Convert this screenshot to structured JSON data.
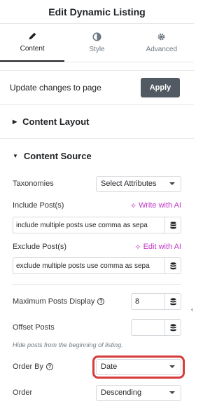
{
  "header": {
    "title": "Edit Dynamic Listing"
  },
  "tabs": [
    {
      "label": "Content",
      "icon": "pencil-icon"
    },
    {
      "label": "Style",
      "icon": "contrast-icon"
    },
    {
      "label": "Advanced",
      "icon": "gear-icon"
    }
  ],
  "apply": {
    "label": "Update changes to page",
    "button": "Apply"
  },
  "sections": {
    "layout": "Content Layout",
    "source": "Content Source"
  },
  "fields": {
    "taxonomies": {
      "label": "Taxonomies",
      "value": "Select Attributes"
    },
    "include": {
      "label": "Include Post(s)",
      "ai": "Write with AI",
      "value": "include multiple posts use comma as sepa"
    },
    "exclude": {
      "label": "Exclude Post(s)",
      "ai": "Edit with AI",
      "value": "exclude multiple posts use comma as sepa"
    },
    "max_posts": {
      "label": "Maximum Posts Display",
      "value": "8"
    },
    "offset": {
      "label": "Offset Posts",
      "value": "",
      "hint": "Hide posts from the beginning of listing."
    },
    "order_by": {
      "label": "Order By",
      "value": "Date"
    },
    "order": {
      "label": "Order",
      "value": "Descending"
    }
  },
  "colors": {
    "accent_ai": "#c036c7",
    "highlight": "#d63c3c",
    "button": "#515962"
  }
}
